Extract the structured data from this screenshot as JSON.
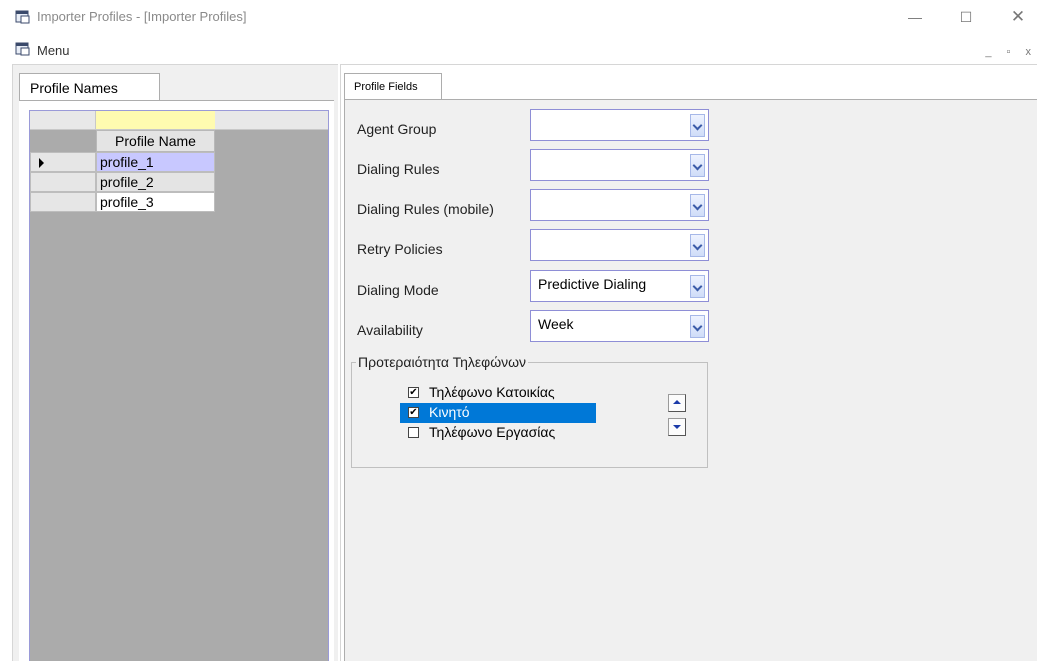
{
  "window": {
    "title": "Importer Profiles - [Importer Profiles]",
    "minimize_glyph": "—",
    "maximize_glyph": "☐",
    "close_glyph": "✕"
  },
  "menubar": {
    "menu_label": "Menu",
    "mdi_controls": "_ ▫ x"
  },
  "left": {
    "tab_label": "Profile Names",
    "grid": {
      "column_header": "Profile Name",
      "rows": [
        "profile_1",
        "profile_2",
        "profile_3"
      ],
      "current_row": 0
    }
  },
  "right": {
    "tab_label": "Profile Fields",
    "fields": [
      {
        "label": "Agent Group",
        "value": ""
      },
      {
        "label": "Dialing Rules",
        "value": ""
      },
      {
        "label": "Dialing Rules (mobile)",
        "value": ""
      },
      {
        "label": "Retry Policies",
        "value": ""
      },
      {
        "label": "Dialing Mode",
        "value": "Predictive Dialing"
      },
      {
        "label": "Availability",
        "value": "Week"
      }
    ],
    "phone_priority": {
      "title": "Προτεραιότητα Τηλεφώνων",
      "items": [
        {
          "label": "Τηλέφωνο Κατοικίας",
          "checked": true,
          "selected": false
        },
        {
          "label": "Κινητό",
          "checked": true,
          "selected": true
        },
        {
          "label": "Τηλέφωνο Εργασίας",
          "checked": false,
          "selected": false
        }
      ]
    }
  },
  "colors": {
    "selection": "#0078d7",
    "grid_current_row": "#c8c8ff",
    "grid_header_highlight": "#fffbb0",
    "grid_background": "#ababab"
  }
}
